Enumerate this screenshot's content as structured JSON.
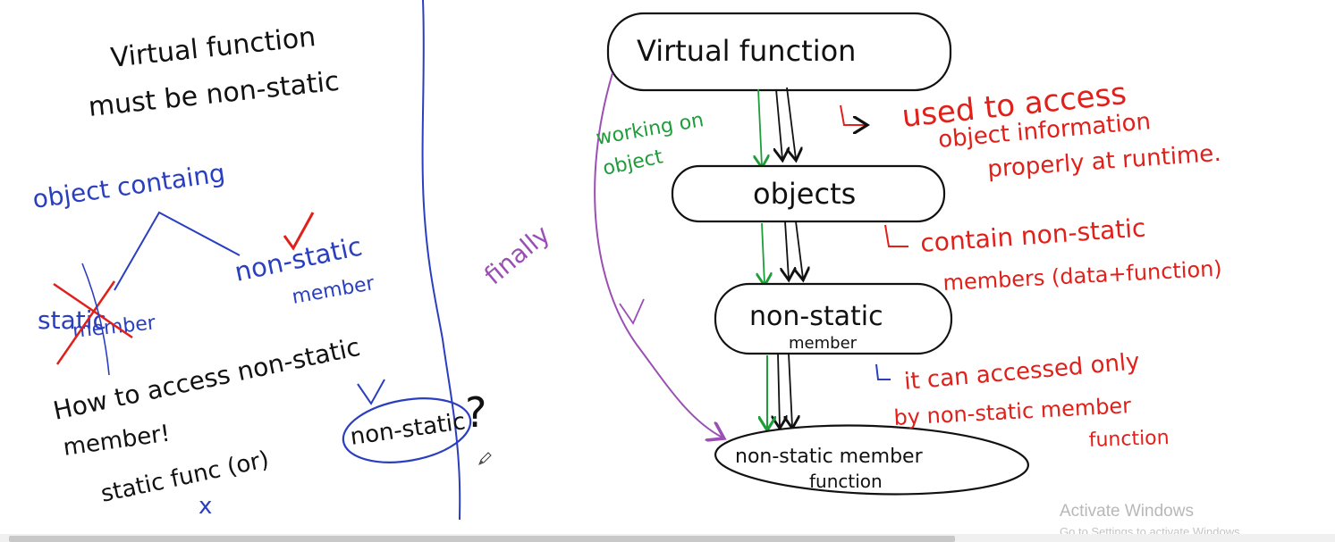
{
  "canvas": {
    "background": "#ffffff"
  },
  "colors": {
    "blue": "#2a3fbf",
    "black": "#111111",
    "red": "#e0201a",
    "green": "#1f9d3a",
    "purple": "#9b4fb5"
  },
  "left_panel": {
    "title_line1": "Virtual function",
    "title_line2": "must be non-static",
    "object_containing": "object containg",
    "static_member_1": "static",
    "static_member_2": "member",
    "nonstatic_member_1": "non-static",
    "nonstatic_member_2": "member",
    "question_1": "How to access non-static",
    "question_2": "member!",
    "answer_prefix": "static func (or)",
    "answer_circled": "non-static",
    "question_mark": "?",
    "cross": "x"
  },
  "diagram": {
    "box_virtual": "Virtual function",
    "box_objects": "objects",
    "box_nonstatic_1": "non-static",
    "box_nonstatic_2": "member",
    "box_func_1": "non-static member",
    "box_func_2": "function",
    "working_on_1": "working on",
    "working_on_2": "object",
    "finally": "finally"
  },
  "notes": {
    "note1_line1": "used to access",
    "note1_line2": "object information",
    "note1_line3": "properly at runtime.",
    "note2_line1": "contain non-static",
    "note2_line2": "members (data+function)",
    "note3_line1": "it can accessed only",
    "note3_line2": "by non-static member",
    "note3_line3": "function"
  },
  "watermark": {
    "title": "Activate Windows",
    "subtitle": "Go to Settings to activate Windows."
  }
}
